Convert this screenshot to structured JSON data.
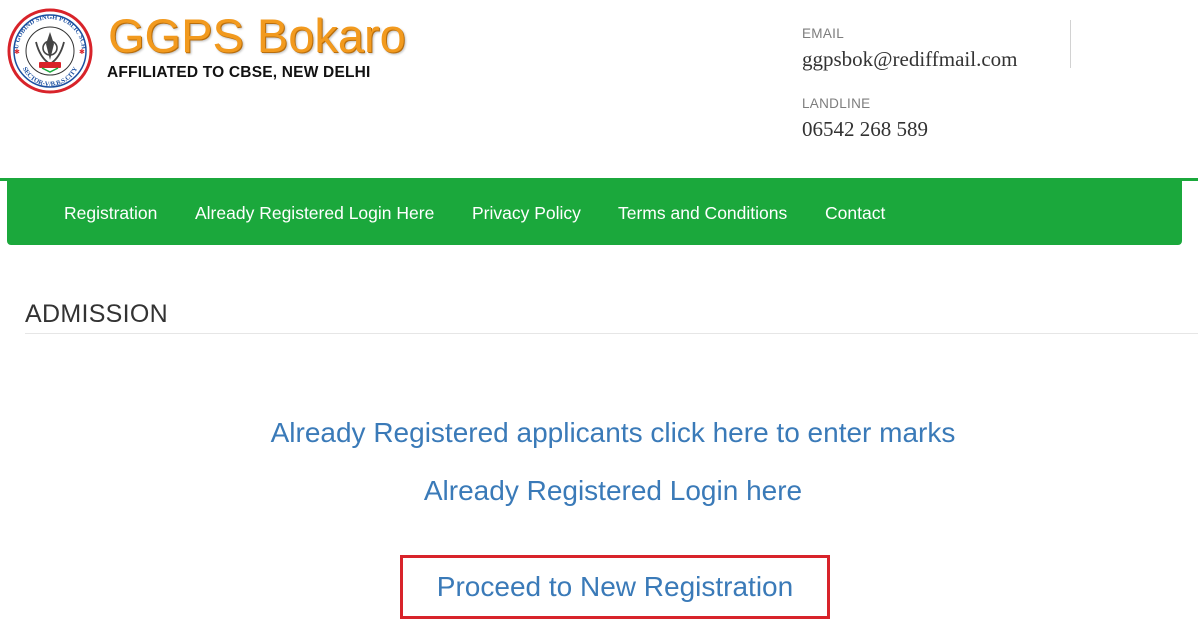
{
  "header": {
    "school_name": "GGPS Bokaro",
    "affiliation": "AFFILIATED TO CBSE, NEW DELHI",
    "email_label": "EMAIL",
    "email_value": "ggpsbok@rediffmail.com",
    "landline_label": "LANDLINE",
    "landline_value": "06542 268 589",
    "logo_seal_text": "GURU GOBIND SINGH PUBLIC SCHOOL SECTOR-V/B,B.S.CITY",
    "brand_color": "#f29a1e"
  },
  "nav": {
    "color": "#1ba83c",
    "items": [
      {
        "label": "Registration"
      },
      {
        "label": "Already Registered Login Here"
      },
      {
        "label": "Privacy Policy"
      },
      {
        "label": "Terms and Conditions"
      },
      {
        "label": "Contact"
      }
    ]
  },
  "main": {
    "title": "ADMISSION",
    "links": {
      "enter_marks": "Already Registered applicants click here to enter marks",
      "login": "Already Registered Login here",
      "new_registration": "Proceed to New Registration"
    },
    "link_color": "#3a7ab8",
    "highlight_color": "#d8232a"
  }
}
